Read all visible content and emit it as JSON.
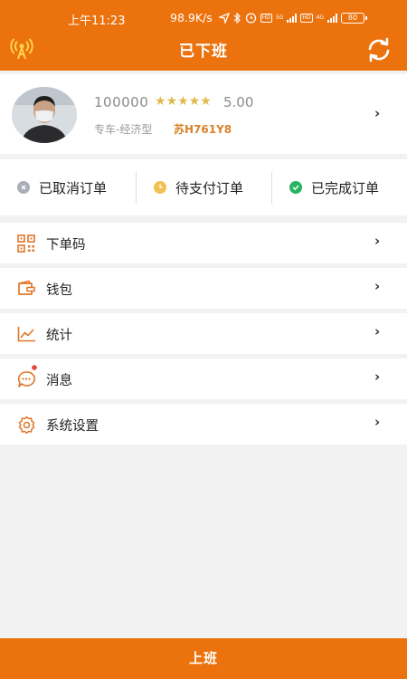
{
  "status_bar": {
    "time": "上午11:23",
    "speed": "98.9K/s",
    "net_5g": "5G",
    "net_4g": "4G",
    "hd": "HD",
    "battery": "80"
  },
  "header": {
    "title": "已下班"
  },
  "profile": {
    "driver_id": "100000",
    "rating_stars": 5,
    "rating_value": "5.00",
    "car_type": "专车-经济型",
    "plate": "苏H761Y8",
    "star_char": "★"
  },
  "orders": {
    "cancelled": "已取消订单",
    "pending_payment": "待支付订单",
    "completed": "已完成订单"
  },
  "menu": {
    "items": [
      {
        "label": "下单码",
        "icon": "qr-code-icon"
      },
      {
        "label": "钱包",
        "icon": "wallet-icon"
      },
      {
        "label": "统计",
        "icon": "stats-icon"
      },
      {
        "label": "消息",
        "icon": "message-icon"
      },
      {
        "label": "系统设置",
        "icon": "settings-icon"
      }
    ]
  },
  "chevron": "›",
  "bottom_action": {
    "label": "上班"
  },
  "colors": {
    "brand_orange": "#ec720e",
    "star_gold": "#e3b84c",
    "plate_orange": "#d9822b",
    "cancelled_gray": "#a9aeb8",
    "pending_yellow": "#f2c250",
    "completed_green": "#27b460"
  }
}
